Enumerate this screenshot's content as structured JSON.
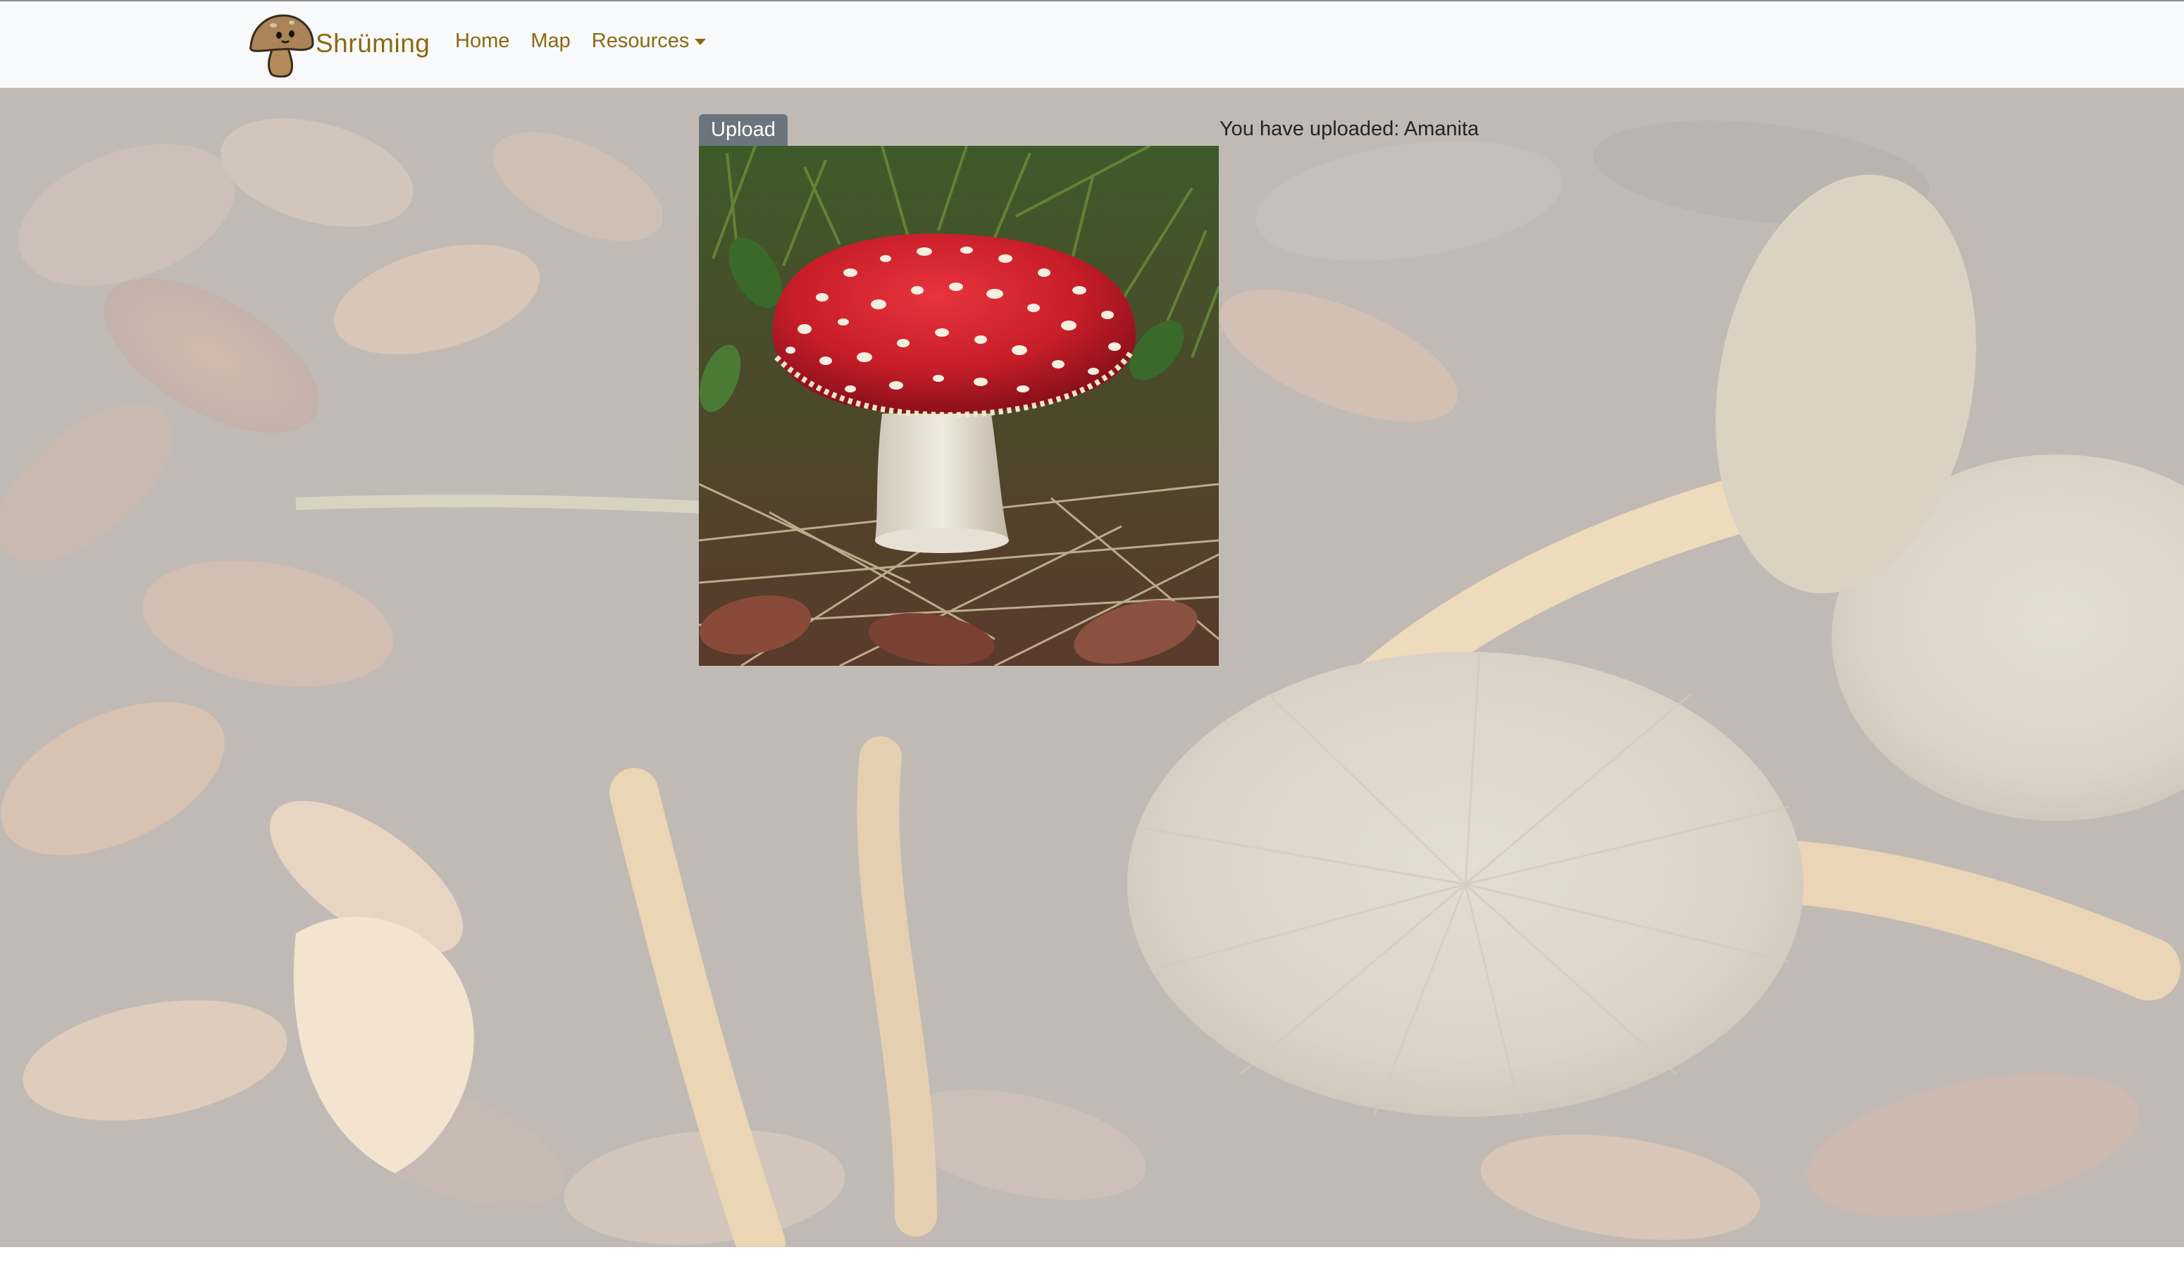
{
  "brand": {
    "name": "Shrüming",
    "logo_icon": "mushroom-mascot-icon"
  },
  "nav": {
    "items": [
      {
        "label": "Home"
      },
      {
        "label": "Map"
      },
      {
        "label": "Resources"
      }
    ],
    "dropdown_icon": "caret-down-icon"
  },
  "upload": {
    "button_label": "Upload",
    "image_icon": "amanita-mushroom-photo"
  },
  "result": {
    "text": "You have uploaded: Amanita"
  },
  "colors": {
    "brand": "#8b6914",
    "navbar_bg": "#f8f9fa",
    "badge_bg": "#6c757d",
    "text": "#212529"
  }
}
